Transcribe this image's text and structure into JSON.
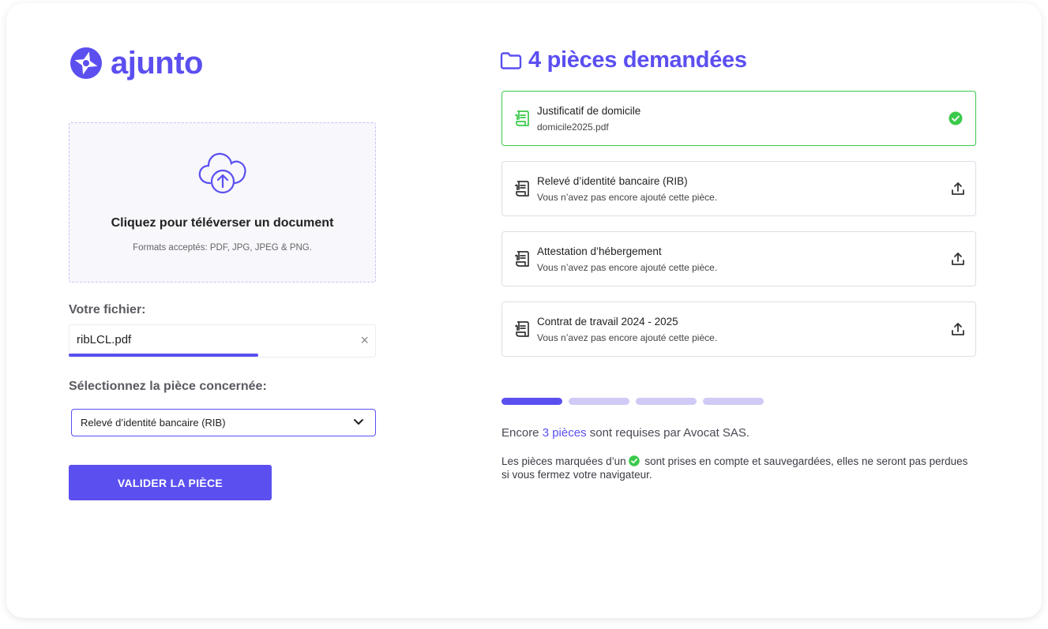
{
  "brand": {
    "name": "ajunto",
    "color": "#5b4ff0"
  },
  "upload": {
    "title": "Cliquez pour téléverser un document",
    "formats": "Formats acceptés: PDF, JPG, JPEG & PNG.",
    "icon": "cloud-upload-icon"
  },
  "file": {
    "label": "Votre fichier:",
    "name": "ribLCL.pdf",
    "clear": "×",
    "progress": 0.62
  },
  "piece_select": {
    "label": "Sélectionnez la pièce concernée:",
    "value": "Relevé d’identité bancaire (RIB)"
  },
  "submit": {
    "label": "VALIDER LA PIÈCE"
  },
  "pieces_panel": {
    "title": "4 pièces demandées",
    "icon": "folder-icon",
    "items": [
      {
        "title": "Justificatif de domicile",
        "subtitle": "domicile2025.pdf",
        "status": "done"
      },
      {
        "title": "Relevé d’identité bancaire (RIB)",
        "subtitle": "Vous n’avez pas encore ajouté cette pièce.",
        "status": "pending"
      },
      {
        "title": "Attestation d’hébergement",
        "subtitle": "Vous n’avez pas encore ajouté cette pièce.",
        "status": "pending"
      },
      {
        "title": "Contrat de travail 2024 - 2025",
        "subtitle": "Vous n’avez pas encore ajouté cette pièce.",
        "status": "pending"
      }
    ],
    "progress": {
      "steps": 4,
      "completed": 1
    }
  },
  "summary": {
    "prefix": "Encore ",
    "highlight": "3 pièces",
    "suffix": " sont requises par Avocat SAS.",
    "note_before": "Les pièces marquées d’un",
    "note_after": " sont prises en compte et sauvegardées, elles ne seront pas perdues si vous fermez votre navigateur."
  },
  "colors": {
    "accent": "#5b4ff0",
    "success": "#3bc94b",
    "progress_off": "#cfcbf6"
  }
}
